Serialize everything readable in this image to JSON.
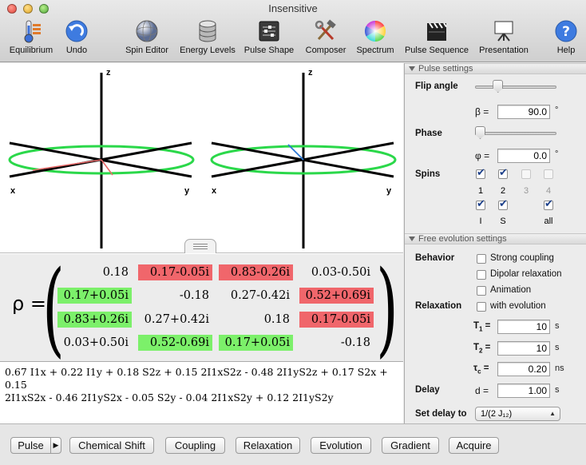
{
  "window": {
    "title": "Insensitive"
  },
  "toolbar": {
    "items": [
      {
        "label": "Equilibrium",
        "icon": "thermometer-icon"
      },
      {
        "label": "Undo",
        "icon": "undo-arrow-icon"
      },
      {
        "label": "Spin Editor",
        "icon": "sphere-icon"
      },
      {
        "label": "Energy Levels",
        "icon": "database-cylinder-icon"
      },
      {
        "label": "Pulse Shape",
        "icon": "sliders-icon"
      },
      {
        "label": "Composer",
        "icon": "tools-icon"
      },
      {
        "label": "Spectrum",
        "icon": "color-wheel-icon"
      },
      {
        "label": "Pulse Sequence",
        "icon": "clapperboard-icon"
      },
      {
        "label": "Presentation",
        "icon": "easel-icon"
      },
      {
        "label": "Help",
        "icon": "help-icon"
      }
    ]
  },
  "plots": {
    "left": {
      "z": "z",
      "x": "x",
      "y": "y"
    },
    "right": {
      "z": "z",
      "x": "x",
      "y": "y"
    },
    "ring_color": "#2bd84a",
    "left_vector_color": "#e86a6a",
    "right_vector_color": "#2b78d6"
  },
  "matrix": {
    "symbol": "ρ =",
    "rows": [
      [
        {
          "v": "0.18",
          "c": ""
        },
        {
          "v": "0.17-0.05i",
          "c": "red"
        },
        {
          "v": "0.83-0.26i",
          "c": "red"
        },
        {
          "v": "0.03-0.50i",
          "c": ""
        }
      ],
      [
        {
          "v": "0.17+0.05i",
          "c": "green"
        },
        {
          "v": "-0.18",
          "c": ""
        },
        {
          "v": "0.27-0.42i",
          "c": ""
        },
        {
          "v": "0.52+0.69i",
          "c": "red"
        }
      ],
      [
        {
          "v": "0.83+0.26i",
          "c": "green"
        },
        {
          "v": "0.27+0.42i",
          "c": ""
        },
        {
          "v": "0.18",
          "c": ""
        },
        {
          "v": "0.17-0.05i",
          "c": "red"
        }
      ],
      [
        {
          "v": "0.03+0.50i",
          "c": ""
        },
        {
          "v": "0.52-0.69i",
          "c": "green"
        },
        {
          "v": "0.17+0.05i",
          "c": "green"
        },
        {
          "v": "-0.18",
          "c": ""
        }
      ]
    ]
  },
  "operator_text": {
    "line1": "0.67 I1x + 0.22 I1y + 0.18 S2z + 0.15 2I1xS2z - 0.48 2I1yS2z + 0.17 S2x + 0.15",
    "line2": "2I1xS2x - 0.46 2I1yS2x - 0.05 S2y - 0.04 2I1xS2y + 0.12 2I1yS2y"
  },
  "pulse_settings": {
    "header": "Pulse settings",
    "flip_angle_label": "Flip angle",
    "flip_angle_symbol": "β =",
    "flip_angle_value": "90.0",
    "flip_angle_unit": "°",
    "flip_slider_fraction": 0.25,
    "phase_label": "Phase",
    "phase_symbol": "φ =",
    "phase_value": "0.0",
    "phase_unit": "°",
    "phase_slider_fraction": 0.0,
    "spins_label": "Spins",
    "spin_checks": [
      {
        "num": "1",
        "checked": true,
        "enabled": true
      },
      {
        "num": "2",
        "checked": true,
        "enabled": true
      },
      {
        "num": "3",
        "checked": false,
        "enabled": false
      },
      {
        "num": "4",
        "checked": false,
        "enabled": false
      }
    ],
    "group_checks": [
      {
        "label": "I",
        "checked": true
      },
      {
        "label": "S",
        "checked": true
      },
      {
        "label": "all",
        "checked": true
      }
    ]
  },
  "free_evolution": {
    "header": "Free evolution settings",
    "behavior_label": "Behavior",
    "behavior_options": [
      "Strong coupling",
      "Dipolar relaxation",
      "Animation"
    ],
    "relaxation_label": "Relaxation",
    "relaxation_option": "with evolution",
    "t1_label": "T1",
    "t1_sub": "1",
    "t1_value": "10",
    "t1_unit": "s",
    "t2_label": "T2",
    "t2_sub": "2",
    "t2_value": "10",
    "t2_unit": "s",
    "tc_label": "τc",
    "tc_sub": "c",
    "tc_value": "0.20",
    "tc_unit": "ns",
    "delay_label": "Delay",
    "delay_symbol": "d =",
    "delay_value": "1.00",
    "delay_unit": "s",
    "set_delay_label": "Set delay to",
    "set_delay_value": "1/(2 J₁₂)"
  },
  "bottom_buttons": [
    "Pulse",
    "Chemical Shift",
    "Coupling",
    "Relaxation",
    "Evolution",
    "Gradient",
    "Acquire"
  ]
}
